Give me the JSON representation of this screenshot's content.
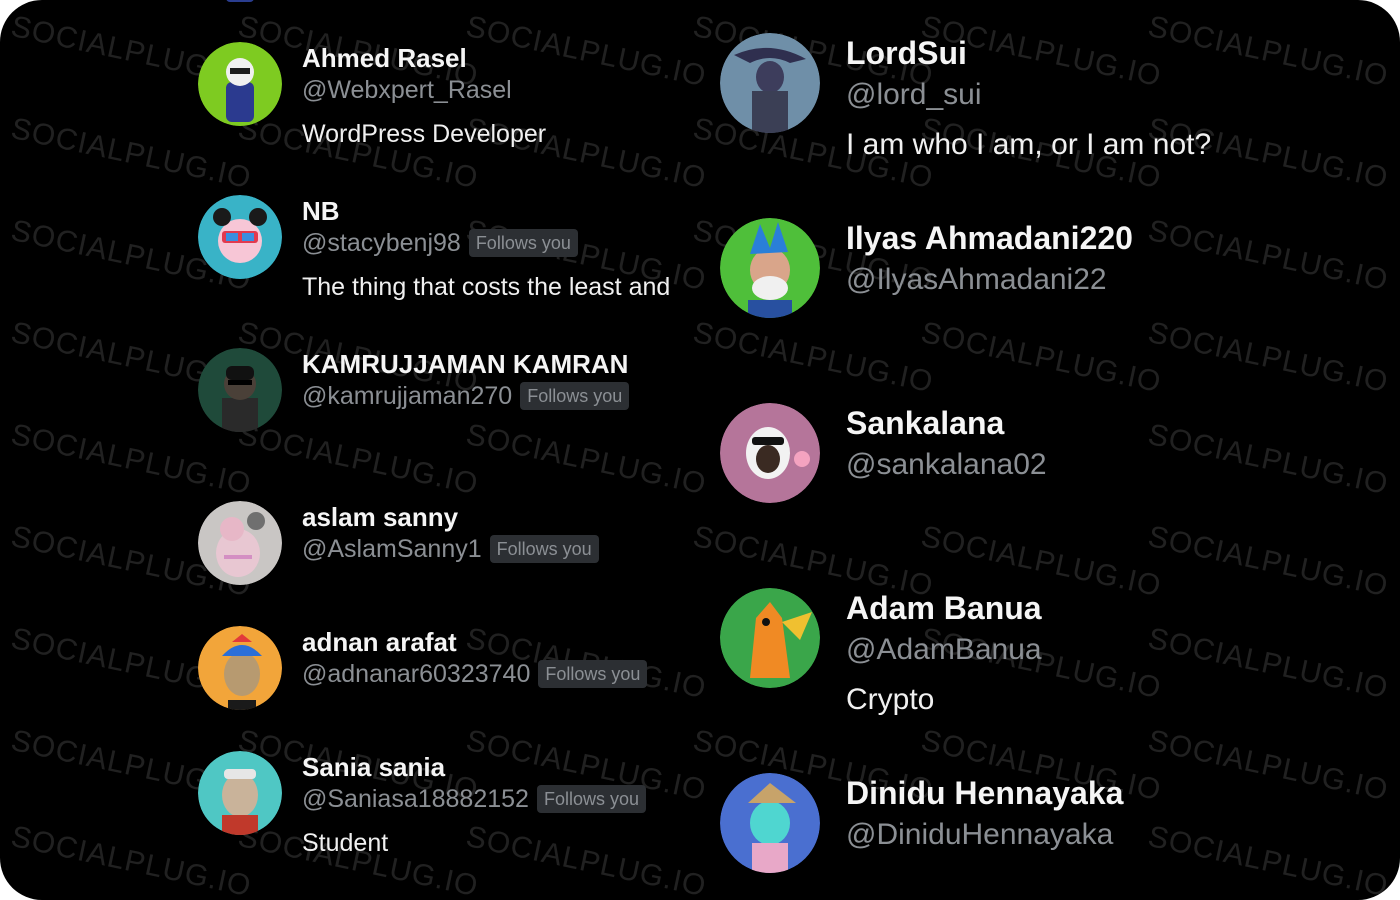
{
  "watermark_text": "SOCIALPLUG.IO",
  "left_users": [
    {
      "name": "Ahmed Rasel",
      "handle": "@Webxpert_Rasel",
      "follows_you": "",
      "bio": "WordPress Developer",
      "avatar_color": "#7ecb21"
    },
    {
      "name": "NB",
      "handle": "@stacybenj98",
      "follows_you": "Follows you",
      "bio": "The thing that costs the least and",
      "avatar_color": "#39b3c7"
    },
    {
      "name": "KAMRUJJAMAN KAMRAN",
      "handle": "@kamrujjaman270",
      "follows_you": "Follows you",
      "bio": "",
      "avatar_color": "#1f4a3a"
    },
    {
      "name": "aslam sanny",
      "handle": "@AslamSanny1",
      "follows_you": "Follows you",
      "bio": "",
      "avatar_color": "#c9c6c4"
    },
    {
      "name": "adnan arafat",
      "handle": "@adnanar60323740",
      "follows_you": "Follows you",
      "bio": "",
      "avatar_color": "#f2a53a"
    },
    {
      "name": "Sania sania",
      "handle": "@Saniasa18882152",
      "follows_you": "Follows you",
      "bio": "Student",
      "avatar_color": "#4fc7c4"
    }
  ],
  "right_users": [
    {
      "name": "LordSui",
      "handle": "@lord_sui",
      "bio": "I am who I am, or I am not?",
      "avatar_color": "#6f8fa8"
    },
    {
      "name": "Ilyas Ahmadani220",
      "handle": "@IlyasAhmadani22",
      "bio": "",
      "avatar_color": "#4fbf3a"
    },
    {
      "name": "Sankalana",
      "handle": "@sankalana02",
      "bio": "",
      "avatar_color": "#b5759a"
    },
    {
      "name": "Adam Banua",
      "handle": "@AdamBanua",
      "bio": "Crypto",
      "avatar_color": "#3aa64a"
    },
    {
      "name": "Dinidu Hennayaka",
      "handle": "@DiniduHennayaka",
      "bio": "",
      "avatar_color": "#4a6fd0"
    }
  ]
}
